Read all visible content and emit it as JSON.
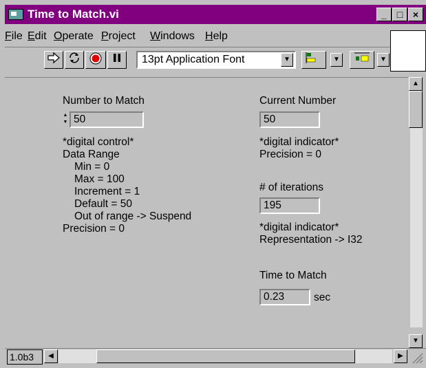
{
  "window": {
    "title": "Time to Match.vi"
  },
  "title_buttons": {
    "minimize": "_",
    "maximize": "□",
    "close": "×"
  },
  "menu": [
    {
      "pre": "",
      "u": "F",
      "post": "ile"
    },
    {
      "pre": "",
      "u": "E",
      "post": "dit"
    },
    {
      "pre": "",
      "u": "O",
      "post": "perate"
    },
    {
      "pre": "",
      "u": "P",
      "post": "roject"
    },
    {
      "pre": "",
      "u": "W",
      "post": "indows"
    },
    {
      "pre": "",
      "u": "H",
      "post": "elp"
    }
  ],
  "toolbar": {
    "run_icon": "run-arrow-icon",
    "run_continuous_icon": "run-continuously-icon",
    "abort_icon": "abort-stop-icon",
    "pause_icon": "pause-icon",
    "font": "13pt Application Font",
    "align_icon": "align-objects-icon",
    "distribute_icon": "distribute-objects-icon"
  },
  "left_column": {
    "number_to_match": {
      "label": "Number to Match",
      "value": "50"
    },
    "desc": [
      "*digital control*",
      "Data Range"
    ],
    "range_items": [
      "Min = 0",
      "Max = 100",
      "Increment = 1",
      "Default = 50",
      "Out of range -> Suspend"
    ],
    "precision": "Precision = 0"
  },
  "right_column": {
    "current_number": {
      "label": "Current Number",
      "value": "50",
      "desc1": "*digital indicator*",
      "desc2": "Precision = 0"
    },
    "iterations": {
      "label": "# of iterations",
      "value": "195",
      "desc1": "*digital indicator*",
      "desc2": "Representation -> I32"
    },
    "time_to_match": {
      "label": "Time to Match",
      "value": "0.23",
      "unit": "sec"
    }
  },
  "status": {
    "version": "1.0b3"
  }
}
